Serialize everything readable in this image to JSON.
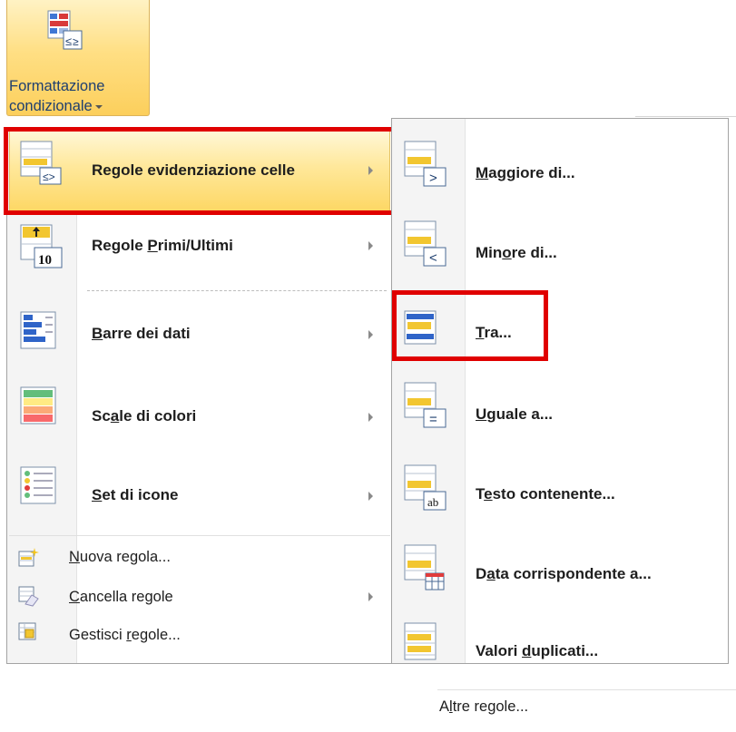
{
  "ribbon": {
    "button_line1": "Formattazione",
    "button_line2": "condizionale",
    "button_icon": "conditional-formatting-icon"
  },
  "main_menu": {
    "items": [
      {
        "label": "Regole evidenziazione celle",
        "icon": "highlight-cells-rules-icon",
        "has_submenu": true,
        "highlighted": true
      },
      {
        "label": "Regole Primi/Ultimi",
        "icon": "top-bottom-rules-icon",
        "has_submenu": true
      },
      {
        "label": "Barre dei dati",
        "icon": "data-bars-icon",
        "has_submenu": true
      },
      {
        "label": "Scale di colori",
        "icon": "color-scales-icon",
        "has_submenu": true
      },
      {
        "label": "Set di icone",
        "icon": "icon-sets-icon",
        "has_submenu": true
      }
    ],
    "commands": [
      {
        "label": "Nuova regola...",
        "icon": "new-rule-icon"
      },
      {
        "label": "Cancella regole",
        "icon": "clear-rules-icon",
        "has_submenu": true
      },
      {
        "label": "Gestisci regole...",
        "icon": "manage-rules-icon"
      }
    ]
  },
  "submenu": {
    "items": [
      {
        "label": "Maggiore di...",
        "icon": "greater-than-icon"
      },
      {
        "label": "Minore di...",
        "icon": "less-than-icon"
      },
      {
        "label": "Tra...",
        "icon": "between-icon",
        "boxed": true
      },
      {
        "label": "Uguale a...",
        "icon": "equal-to-icon"
      },
      {
        "label": "Testo contenente...",
        "icon": "text-contains-icon"
      },
      {
        "label": "Data corrispondente a...",
        "icon": "date-occurring-icon"
      },
      {
        "label": "Valori duplicati...",
        "icon": "duplicate-values-icon"
      }
    ],
    "more_rules": "Altre regole..."
  },
  "colors": {
    "highlight": "#fde08a",
    "annotation_red": "#e00000",
    "ribbon_text": "#1e3f6f"
  }
}
